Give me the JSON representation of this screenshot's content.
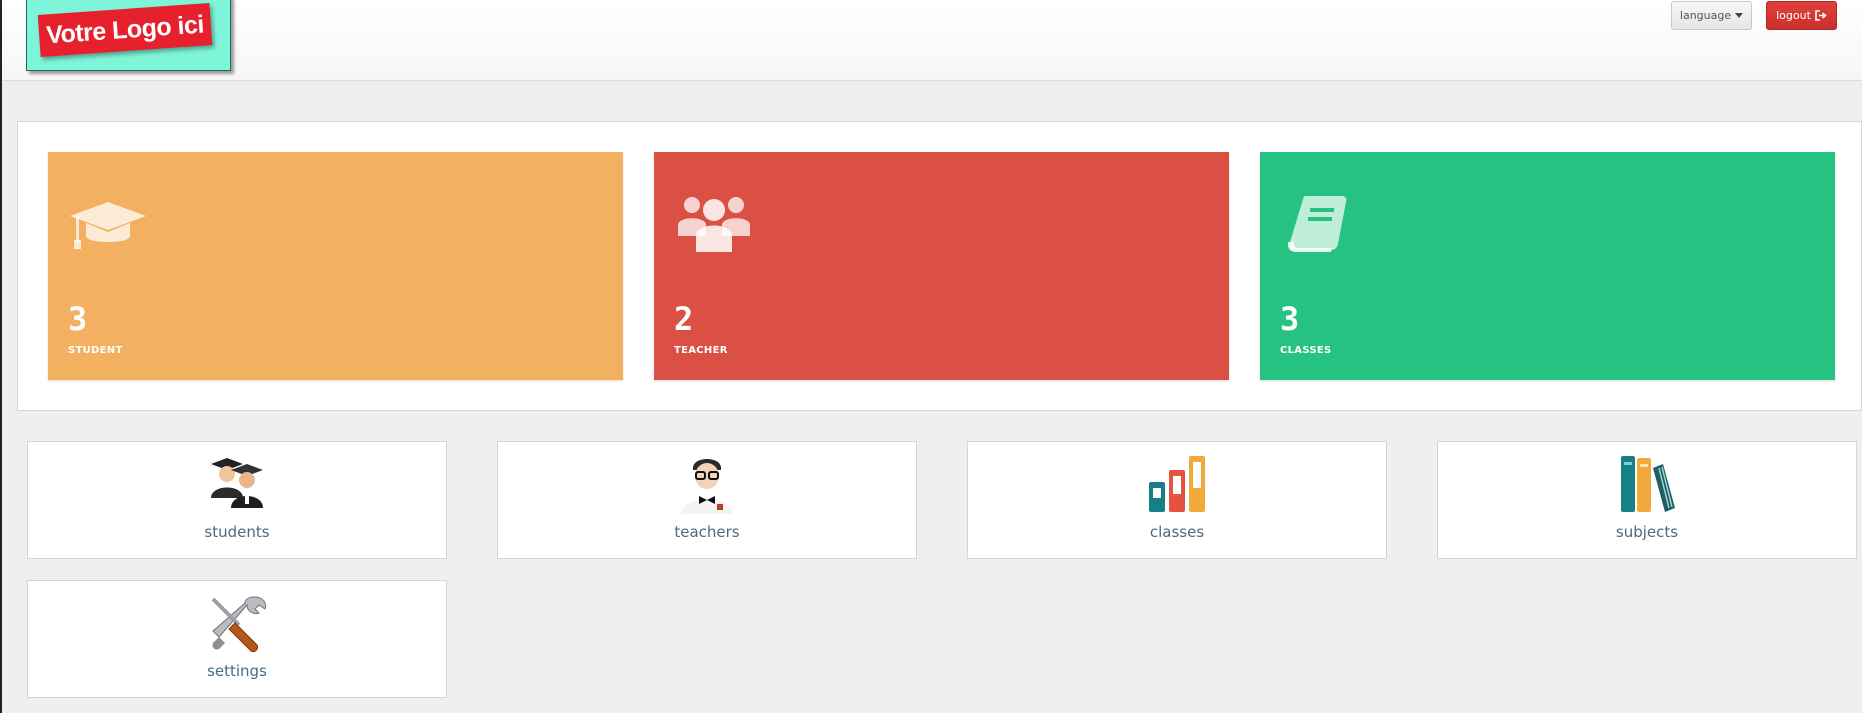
{
  "header": {
    "logo_text": "Votre Logo ici",
    "language_label": "language",
    "logout_label": "logout"
  },
  "colors": {
    "student": "#f3b061",
    "teacher": "#db5044",
    "classes": "#26c281"
  },
  "stats": [
    {
      "count": "3",
      "label": "STUDENT",
      "icon": "graduation-cap-icon"
    },
    {
      "count": "2",
      "label": "TEACHER",
      "icon": "users-icon"
    },
    {
      "count": "3",
      "label": "CLASSES",
      "icon": "book-icon"
    }
  ],
  "nav": [
    {
      "label": "students",
      "icon": "students-icon"
    },
    {
      "label": "teachers",
      "icon": "teacher-icon"
    },
    {
      "label": "classes",
      "icon": "classes-icon"
    },
    {
      "label": "subjects",
      "icon": "subjects-icon"
    },
    {
      "label": "settings",
      "icon": "tools-icon"
    }
  ]
}
